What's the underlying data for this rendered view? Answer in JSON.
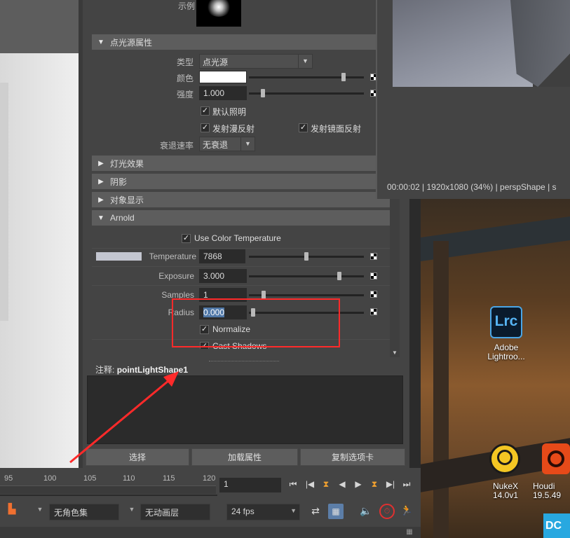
{
  "attr": {
    "sample_label": "示例",
    "section_point_light": "点光源属性",
    "type_label": "类型",
    "type_value": "点光源",
    "color_label": "颜色",
    "intensity_label": "强度",
    "intensity_value": "1.000",
    "illum_default": "默认照明",
    "emit_diffuse": "发射漫反射",
    "emit_specular": "发射镜面反射",
    "decay_label": "衰退速率",
    "decay_value": "无衰退",
    "section_light_effects": "灯光效果",
    "section_shadows": "阴影",
    "section_object_display": "对象显示",
    "section_arnold": "Arnold",
    "use_color_temp": "Use Color Temperature",
    "temperature_label": "Temperature",
    "temperature_value": "7868",
    "exposure_label": "Exposure",
    "exposure_value": "3.000",
    "samples_label": "Samples",
    "samples_value": "1",
    "radius_label": "Radius",
    "radius_value": "0.000",
    "normalize": "Normalize",
    "cast_shadows": "Cast Shadows"
  },
  "notes": {
    "label": "注释:",
    "shape_name": "pointLightShape1"
  },
  "buttons": {
    "select": "选择",
    "load_attributes": "加载属性",
    "copy_tab": "复制选项卡"
  },
  "viewport": {
    "info": "00:00:02 | 1920x1080 (34%) | perspShape  |  s"
  },
  "timeline": {
    "ticks": [
      "95",
      "100",
      "105",
      "110",
      "115",
      "120"
    ],
    "current_frame": "1",
    "character_set": "无角色集",
    "anim_layer": "无动画层",
    "fps": "24 fps"
  },
  "desktop": {
    "lrc_badge": "Lrc",
    "lrc_name_1": "Adobe",
    "lrc_name_2": "Lightroo...",
    "nuke_name_1": "NukeX",
    "nuke_name_2": "14.0v1",
    "houdini_name_1": "Houdi",
    "houdini_name_2": "19.5.49",
    "dcc_badge": "DC"
  },
  "colors": {
    "annotation_red": "#ff2a2a",
    "panel_bg": "#444444",
    "header_bg": "#5d5d5d"
  }
}
